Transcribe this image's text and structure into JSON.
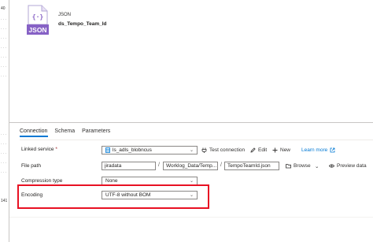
{
  "gutter": {
    "top_number": "40",
    "bottom_number": "141"
  },
  "dataset": {
    "type": "JSON",
    "name": "ds_Tempo_Team_Id",
    "icon_label": "JSON",
    "icon_glyph": "{·}"
  },
  "tabs": [
    {
      "label": "Connection",
      "active": true
    },
    {
      "label": "Schema",
      "active": false
    },
    {
      "label": "Parameters",
      "active": false
    }
  ],
  "form": {
    "linked_service": {
      "label": "Linked service",
      "required_mark": "*",
      "value": "ls_adls_blobncus",
      "test_connection": "Test connection",
      "edit": "Edit",
      "new": "New",
      "learn_more": "Learn more"
    },
    "file_path": {
      "label": "File path",
      "container": "jiradata",
      "directory": "Worklog_Data/Temp...",
      "file": "TempoTeamId.json",
      "browse": "Browse",
      "preview": "Preview data"
    },
    "compression": {
      "label": "Compression type",
      "value": "None"
    },
    "encoding": {
      "label": "Encoding",
      "value": "UTF-8 without BOM"
    }
  },
  "colors": {
    "accent": "#0078d4",
    "highlight": "#e81123",
    "icon_purple": "#8661c5"
  }
}
